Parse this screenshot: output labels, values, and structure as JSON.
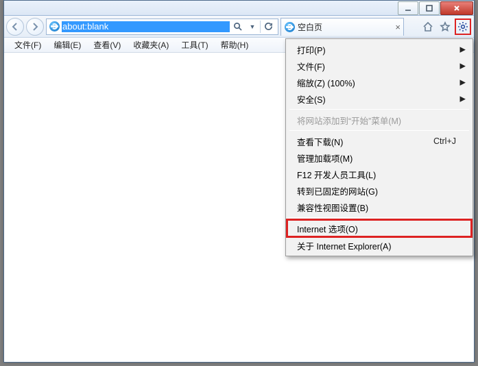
{
  "address_bar": {
    "url": "about:blank"
  },
  "tab": {
    "title": "空白页"
  },
  "menubar": [
    "文件(F)",
    "编辑(E)",
    "查看(V)",
    "收藏夹(A)",
    "工具(T)",
    "帮助(H)"
  ],
  "tools_menu": {
    "print": {
      "label": "打印(P)",
      "submenu": true
    },
    "file": {
      "label": "文件(F)",
      "submenu": true
    },
    "zoom": {
      "label": "缩放(Z) (100%)",
      "submenu": true
    },
    "safety": {
      "label": "安全(S)",
      "submenu": true
    },
    "add_to_start": {
      "label": "将网站添加到“开始”菜单(M)",
      "disabled": true
    },
    "downloads": {
      "label": "查看下载(N)",
      "hotkey": "Ctrl+J"
    },
    "addons": {
      "label": "管理加载项(M)"
    },
    "f12": {
      "label": "F12 开发人员工具(L)"
    },
    "pinned": {
      "label": "转到已固定的网站(G)"
    },
    "compat": {
      "label": "兼容性视图设置(B)"
    },
    "options": {
      "label": "Internet 选项(O)",
      "highlighted": true
    },
    "about": {
      "label": "关于 Internet Explorer(A)"
    }
  }
}
